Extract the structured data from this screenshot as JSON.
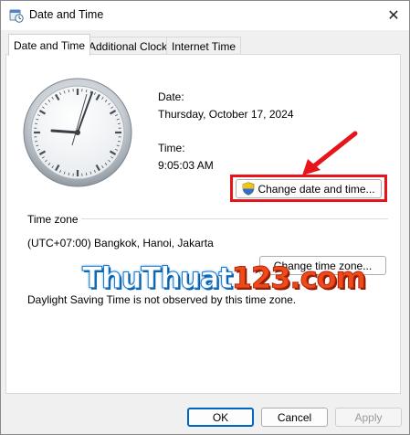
{
  "window": {
    "title": "Date and Time"
  },
  "tabs": [
    {
      "label": "Date and Time",
      "active": true
    },
    {
      "label": "Additional Clocks",
      "active": false
    },
    {
      "label": "Internet Time",
      "active": false
    }
  ],
  "datetime": {
    "date_label": "Date:",
    "date_value": "Thursday, October 17, 2024",
    "time_label": "Time:",
    "time_value": "9:05:03 AM",
    "change_button": "Change date and time..."
  },
  "timezone": {
    "section_label": "Time zone",
    "value": "(UTC+07:00) Bangkok, Hanoi, Jakarta",
    "change_button": "Change time zone...",
    "dst_note": "Daylight Saving Time is not observed by this time zone."
  },
  "footer": {
    "ok": "OK",
    "cancel": "Cancel",
    "apply": "Apply"
  },
  "watermark": {
    "part1": "ThuThuat",
    "part2": "123.com"
  },
  "colors": {
    "highlight": "#e8141b",
    "watermark_blue": "#1d79c9",
    "watermark_orange": "#f04a1b"
  }
}
